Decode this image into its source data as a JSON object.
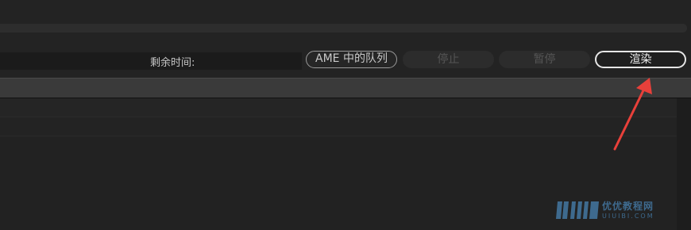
{
  "render_panel": {
    "remaining_time_label": "剩余时间:",
    "remaining_time_value": "",
    "buttons": {
      "ame_queue": "AME 中的队列",
      "stop": "停止",
      "pause": "暂停",
      "render": "渲染"
    }
  },
  "annotation": {
    "arrow_color": "#e8403a",
    "target": "render-button"
  },
  "watermark": {
    "logo_letters": "UiiiUi",
    "main": "优优教程网",
    "sub": "UIUIBI.COM",
    "color": "#3e6a8e"
  }
}
